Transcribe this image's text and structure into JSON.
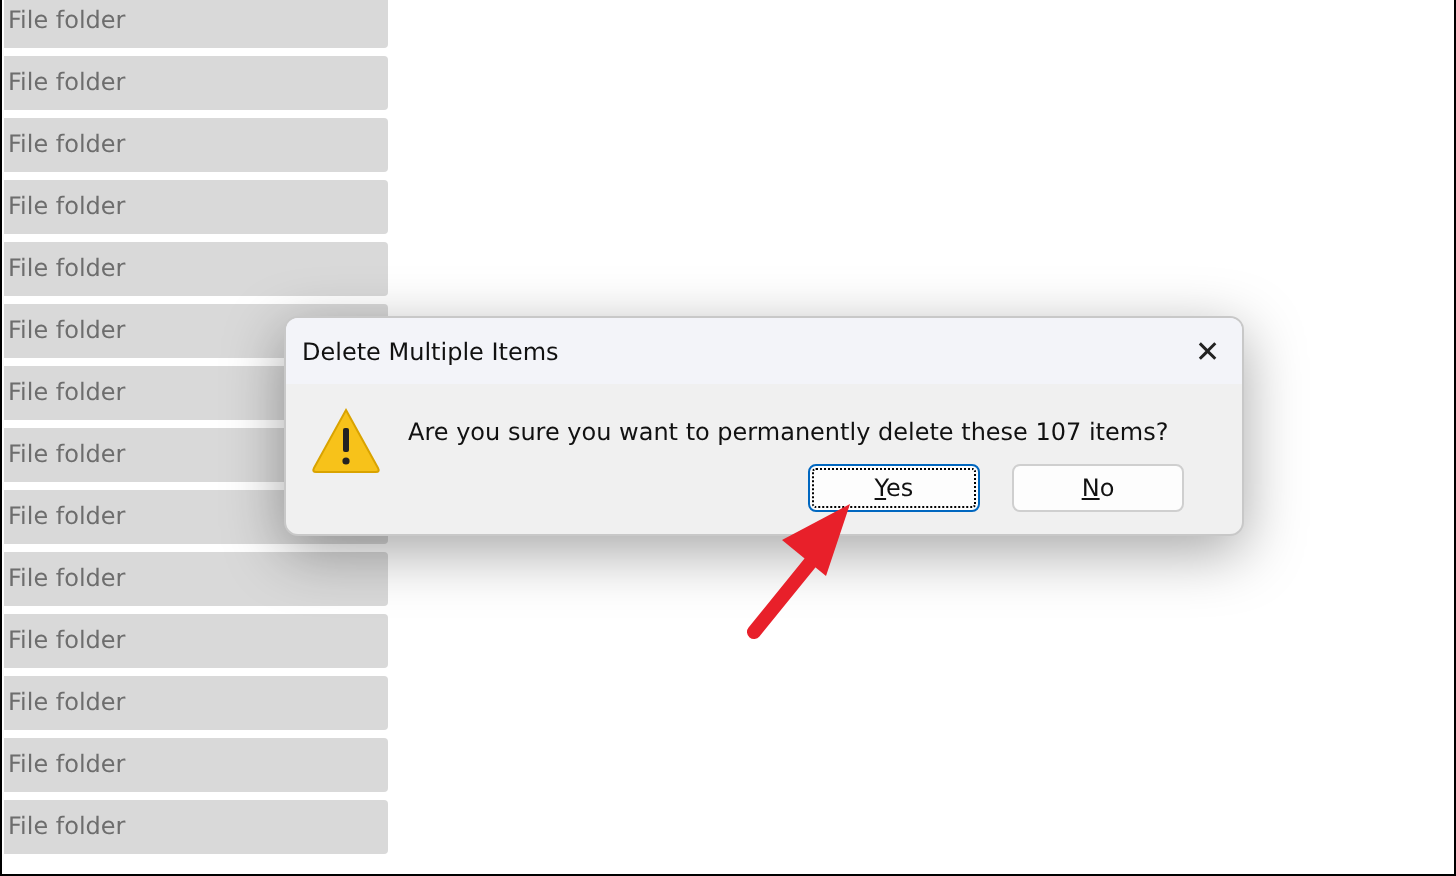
{
  "file_list": {
    "rows": [
      {
        "type": "File folder"
      },
      {
        "type": "File folder"
      },
      {
        "type": "File folder"
      },
      {
        "type": "File folder"
      },
      {
        "type": "File folder"
      },
      {
        "type": "File folder"
      },
      {
        "type": "File folder"
      },
      {
        "type": "File folder"
      },
      {
        "type": "File folder"
      },
      {
        "type": "File folder"
      },
      {
        "type": "File folder"
      },
      {
        "type": "File folder"
      },
      {
        "type": "File folder"
      },
      {
        "type": "File folder"
      }
    ]
  },
  "dialog": {
    "title": "Delete Multiple Items",
    "close": "✕",
    "message": "Are you sure you want to permanently delete these 107 items?",
    "buttons": [
      {
        "access_key": "Y",
        "label_rest": "es",
        "default": true
      },
      {
        "access_key": "N",
        "label_rest": "o",
        "default": false
      }
    ]
  }
}
